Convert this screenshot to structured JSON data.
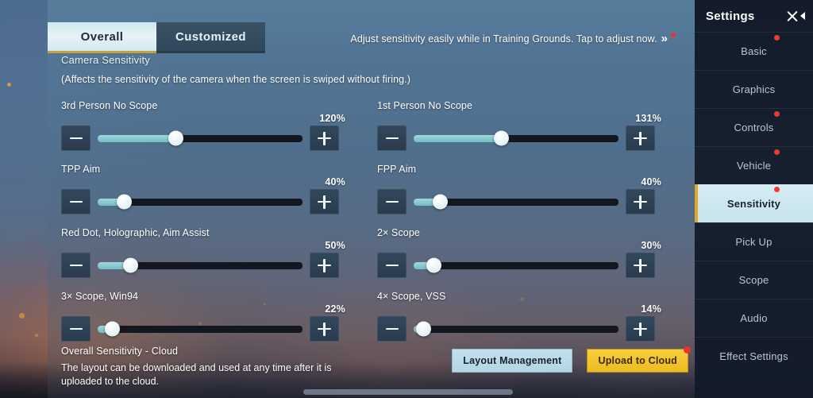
{
  "tabs": [
    {
      "label": "Overall",
      "active": true
    },
    {
      "label": "Customized",
      "active": false
    }
  ],
  "banner": {
    "text": "Adjust sensitivity easily while in Training Grounds. Tap to adjust now.",
    "arrow": "»",
    "has_dot": true
  },
  "section": {
    "title": "Camera Sensitivity",
    "description": "(Affects the sensitivity of the camera when the screen is swiped without firing.)"
  },
  "sliders": [
    {
      "label": "3rd Person No Scope",
      "value": "120%",
      "percent": 38
    },
    {
      "label": "1st Person No Scope",
      "value": "131%",
      "percent": 43
    },
    {
      "label": "TPP Aim",
      "value": "40%",
      "percent": 13
    },
    {
      "label": "FPP Aim",
      "value": "40%",
      "percent": 13
    },
    {
      "label": "Red Dot, Holographic, Aim Assist",
      "value": "50%",
      "percent": 16
    },
    {
      "label": "2× Scope",
      "value": "30%",
      "percent": 10
    },
    {
      "label": "3× Scope, Win94",
      "value": "22%",
      "percent": 7
    },
    {
      "label": "4× Scope, VSS",
      "value": "14%",
      "percent": 5
    }
  ],
  "controls": {
    "minus_label": "minus",
    "plus_label": "plus"
  },
  "cloud": {
    "title": "Overall Sensitivity - Cloud",
    "description": "The layout can be downloaded and used at any time after it is uploaded to the cloud.",
    "layout_button": "Layout Management",
    "upload_button": "Upload to Cloud"
  },
  "sidebar": {
    "title": "Settings",
    "items": [
      {
        "label": "Basic",
        "active": false,
        "dot": true
      },
      {
        "label": "Graphics",
        "active": false,
        "dot": false
      },
      {
        "label": "Controls",
        "active": false,
        "dot": true
      },
      {
        "label": "Vehicle",
        "active": false,
        "dot": true
      },
      {
        "label": "Sensitivity",
        "active": true,
        "dot": true
      },
      {
        "label": "Pick Up",
        "active": false,
        "dot": false
      },
      {
        "label": "Scope",
        "active": false,
        "dot": false
      },
      {
        "label": "Audio",
        "active": false,
        "dot": false
      },
      {
        "label": "Effect Settings",
        "active": false,
        "dot": false
      }
    ]
  },
  "colors": {
    "accent_gold": "#e0a92a",
    "slider_fill": "#8fcdd4",
    "badge_red": "#ef3a2c",
    "panel_active": "#cfe8ef"
  }
}
